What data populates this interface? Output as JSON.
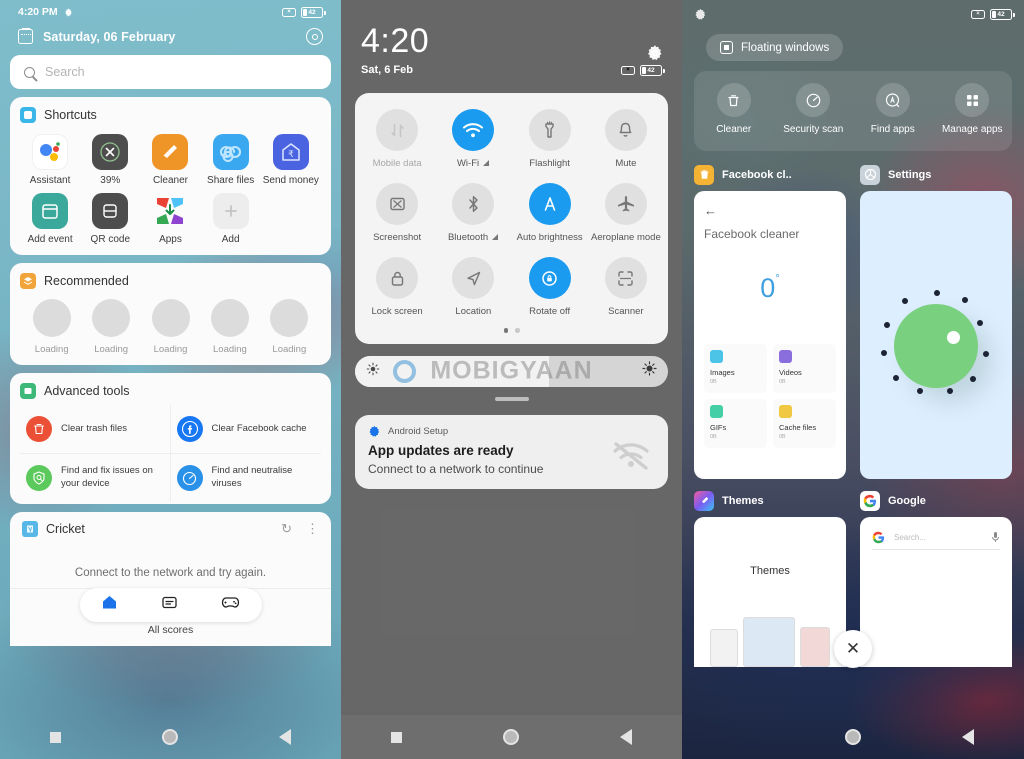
{
  "panel1": {
    "statusbar": {
      "time": "4:20 PM",
      "gear_icon": "gear-icon",
      "silent_icon": "x-box-icon",
      "battery": "42"
    },
    "date_row": {
      "calendar_icon": "calendar-icon",
      "date": "Saturday, 06 February",
      "ring_icon": "circle-target-icon"
    },
    "search": {
      "icon": "search-icon",
      "placeholder": "Search"
    },
    "shortcuts": {
      "title": "Shortcuts",
      "badge_icon": "shortcuts-badge-icon",
      "items": [
        {
          "label": "Assistant",
          "icon": "google-assistant-icon"
        },
        {
          "label": "39%",
          "icon": "battery-cleanup-icon"
        },
        {
          "label": "Cleaner",
          "icon": "broom-icon"
        },
        {
          "label": "Share files",
          "icon": "shareit-infinity-icon"
        },
        {
          "label": "Send money",
          "icon": "house-rupee-icon"
        },
        {
          "label": "Add event",
          "icon": "calendar-add-icon"
        },
        {
          "label": "QR code",
          "icon": "qr-code-icon"
        },
        {
          "label": "Apps",
          "icon": "play-store-icon"
        },
        {
          "label": "Add",
          "icon": "plus-icon"
        }
      ]
    },
    "recommended": {
      "title": "Recommended",
      "badge_icon": "recommended-badge-icon",
      "items": [
        {
          "label": "Loading"
        },
        {
          "label": "Loading"
        },
        {
          "label": "Loading"
        },
        {
          "label": "Loading"
        },
        {
          "label": "Loading"
        }
      ]
    },
    "advanced_tools": {
      "title": "Advanced tools",
      "badge_icon": "tools-badge-icon",
      "items": [
        {
          "label": "Clear trash files",
          "icon": "trash-icon",
          "color": "#eb4f35"
        },
        {
          "label": "Clear Facebook cache",
          "icon": "facebook-icon",
          "color": "#1877f2"
        },
        {
          "label": "Find and fix issues on your device",
          "icon": "shield-search-icon",
          "color": "#5cc95c"
        },
        {
          "label": "Find and neutralise viruses",
          "icon": "scan-virus-icon",
          "color": "#2a91e8"
        }
      ]
    },
    "cricket": {
      "title": "Cricket",
      "badge_icon": "cricket-badge-icon",
      "refresh_icon": "refresh-icon",
      "overflow_icon": "more-vertical-icon",
      "message": "Connect to the network and try again.",
      "tabs": [
        {
          "icon": "home-icon",
          "active": true
        },
        {
          "icon": "scorecard-icon",
          "active": false
        },
        {
          "icon": "gamepad-icon",
          "active": false
        }
      ],
      "footer": "All scores"
    },
    "navbar": {
      "recents_icon": "square-icon",
      "home_icon": "circle-icon",
      "back_icon": "triangle-back-icon"
    }
  },
  "panel2": {
    "time": "4:20",
    "date": "Sat, 6 Feb",
    "gear_icon": "gear-icon",
    "silent_icon": "x-box-icon",
    "battery": "42",
    "tiles": [
      {
        "label": "Mobile data",
        "icon": "mobile-data-icon",
        "on": false,
        "dim": true
      },
      {
        "label": "Wi-Fi",
        "icon": "wifi-icon",
        "on": true,
        "dim": false,
        "suffix": "triangle"
      },
      {
        "label": "Flashlight",
        "icon": "flashlight-icon",
        "on": false,
        "dim": false
      },
      {
        "label": "Mute",
        "icon": "bell-icon",
        "on": false,
        "dim": false
      },
      {
        "label": "Screenshot",
        "icon": "screenshot-icon",
        "on": false,
        "dim": false
      },
      {
        "label": "Bluetooth",
        "icon": "bluetooth-icon",
        "on": false,
        "dim": false,
        "suffix": "triangle"
      },
      {
        "label": "Auto brightness",
        "icon": "auto-brightness-icon",
        "on": true,
        "dim": false
      },
      {
        "label": "Aeroplane mode",
        "icon": "airplane-icon",
        "on": false,
        "dim": false
      },
      {
        "label": "Lock screen",
        "icon": "lock-icon",
        "on": false,
        "dim": false
      },
      {
        "label": "Location",
        "icon": "location-arrow-icon",
        "on": false,
        "dim": false
      },
      {
        "label": "Rotate off",
        "icon": "rotate-lock-icon",
        "on": true,
        "dim": false
      },
      {
        "label": "Scanner",
        "icon": "scanner-frame-icon",
        "on": false,
        "dim": false
      }
    ],
    "page_dots": {
      "count": 2,
      "active": 0
    },
    "brightness": {
      "low_icon": "brightness-low-icon",
      "high_icon": "brightness-high-icon",
      "level_percent": 62
    },
    "watermark": "MOBIGYAAN",
    "notification": {
      "app_icon": "android-setup-gear-icon",
      "app_name": "Android Setup",
      "title": "App updates are ready",
      "subtitle": "Connect to a network to continue",
      "trailing_icon": "wifi-off-icon"
    },
    "navbar": {
      "recents_icon": "square-icon",
      "home_icon": "circle-icon",
      "back_icon": "triangle-back-icon"
    }
  },
  "panel3": {
    "statusbar": {
      "gear_icon": "gear-icon",
      "silent_icon": "x-box-icon",
      "battery": "42"
    },
    "floating_windows": {
      "label": "Floating windows",
      "icon": "floating-window-icon"
    },
    "tools": [
      {
        "label": "Cleaner",
        "icon": "trash-icon"
      },
      {
        "label": "Security scan",
        "icon": "speedometer-icon"
      },
      {
        "label": "Find apps",
        "icon": "search-circle-icon"
      },
      {
        "label": "Manage apps",
        "icon": "grid-apps-icon"
      }
    ],
    "recents": [
      {
        "app_name": "Facebook cl..",
        "app_icon": "facebook-cleaner-icon",
        "preview": {
          "back_icon": "arrow-left-icon",
          "heading": "Facebook cleaner",
          "value": "0",
          "unit": "°",
          "cells": [
            {
              "label": "Images",
              "size": "0B",
              "color": "#4cc4e8"
            },
            {
              "label": "Videos",
              "size": "0B",
              "color": "#8b6ede"
            },
            {
              "label": "GIFs",
              "size": "0B",
              "color": "#45cfa6"
            },
            {
              "label": "Cache files",
              "size": "0B",
              "color": "#f0c841"
            }
          ]
        }
      },
      {
        "app_name": "Settings",
        "app_icon": "settings-gear-icon",
        "preview": {
          "type": "android-loading-blob"
        }
      },
      {
        "app_name": "Themes",
        "app_icon": "themes-icon",
        "preview": {
          "heading": "Themes"
        }
      },
      {
        "app_name": "Google",
        "app_icon": "google-g-icon",
        "preview": {
          "search_placeholder": "Search...",
          "mic_icon": "mic-icon",
          "g_icon": "google-g-icon"
        }
      }
    ],
    "close_button": {
      "icon": "close-icon"
    },
    "navbar": {
      "home_icon": "circle-icon",
      "back_icon": "triangle-back-icon"
    }
  }
}
